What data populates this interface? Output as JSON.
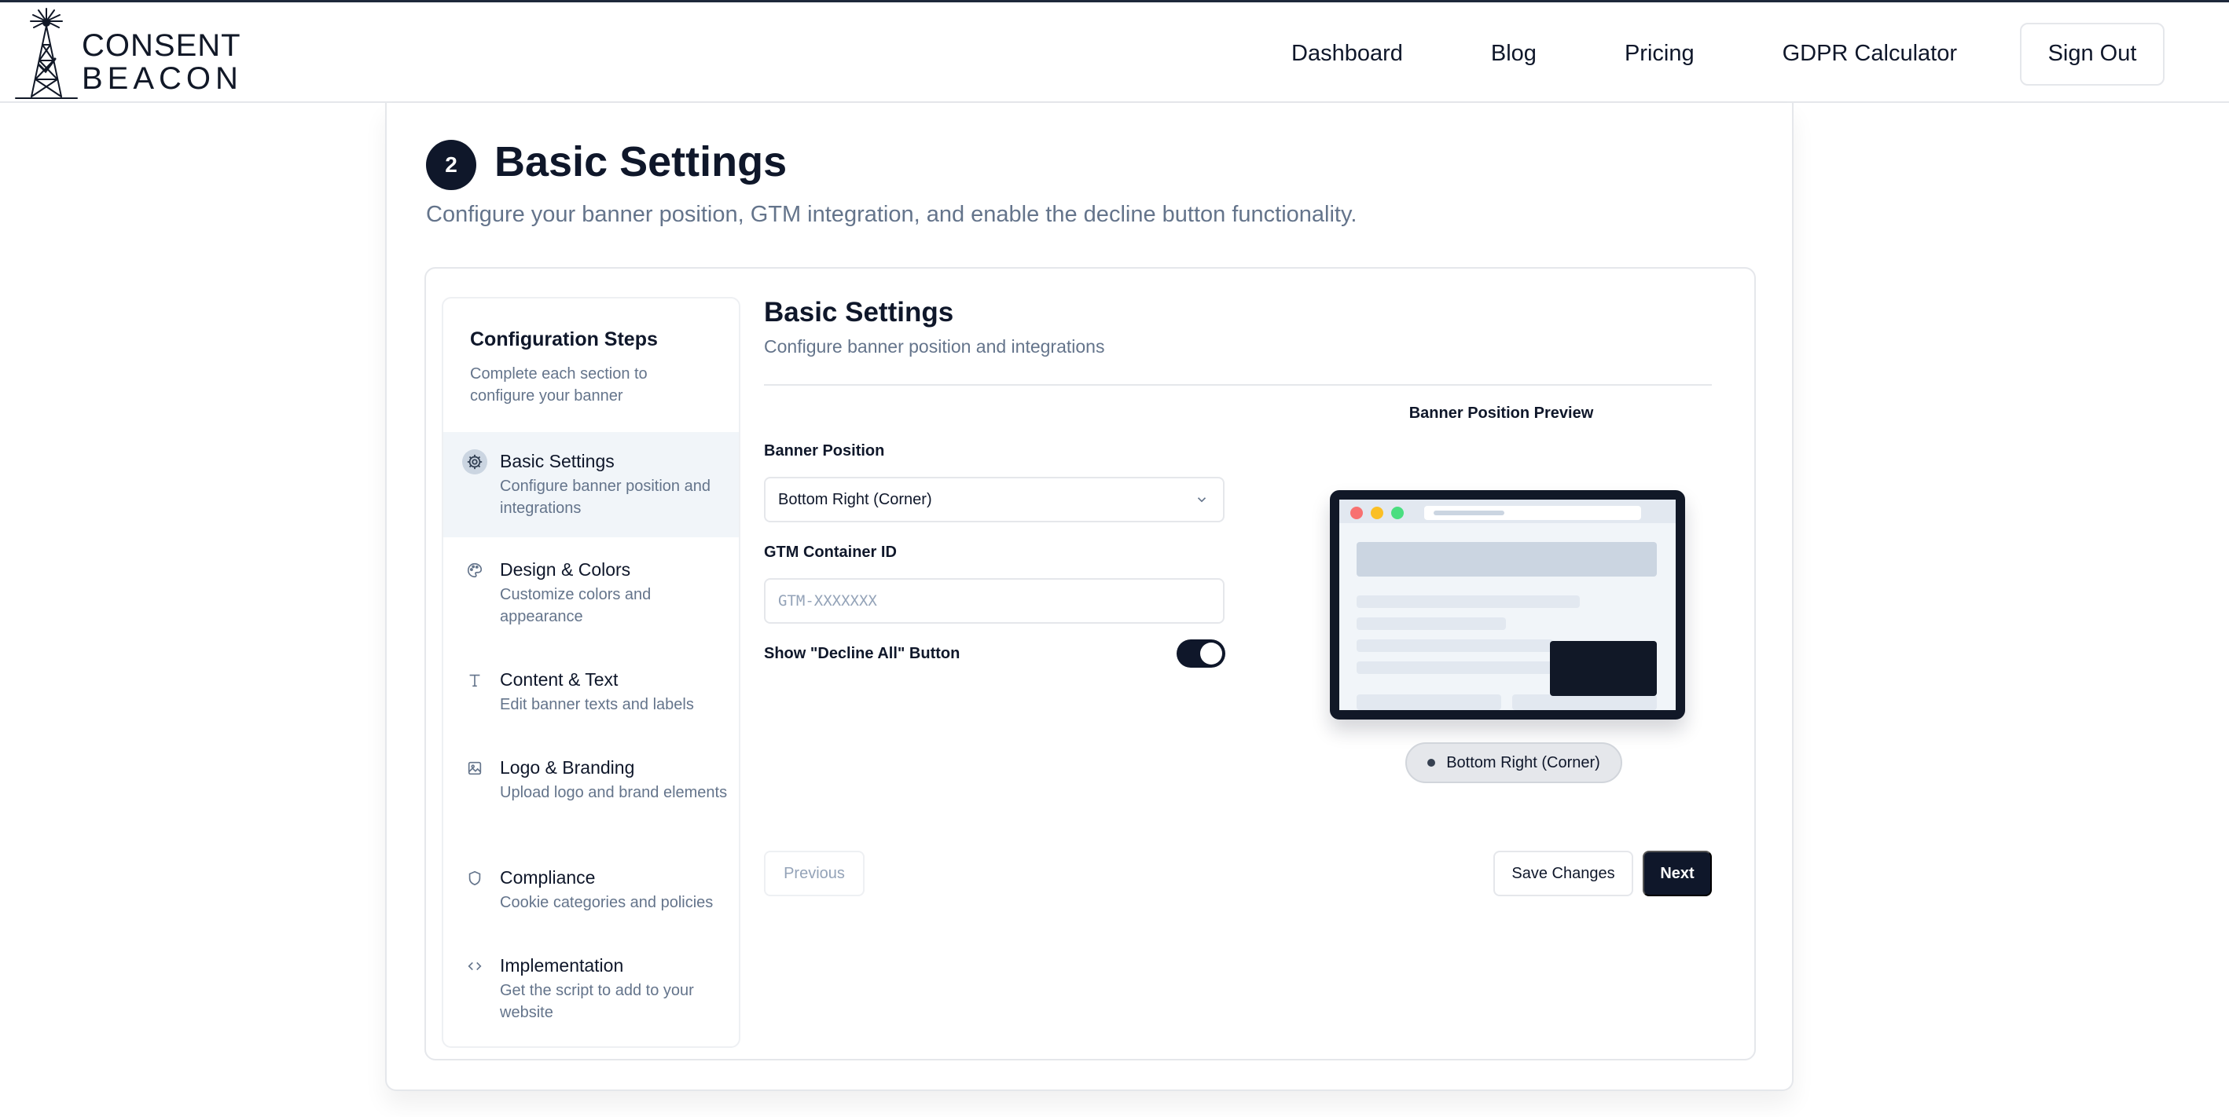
{
  "brand": {
    "line1": "CONSENT",
    "line2": "BEACON"
  },
  "nav": {
    "links": [
      "Dashboard",
      "Blog",
      "Pricing",
      "GDPR Calculator"
    ],
    "sign_out": "Sign Out"
  },
  "step": {
    "number": "2",
    "title": "Basic Settings",
    "description": "Configure your banner position, GTM integration, and enable the decline button functionality."
  },
  "sidebar": {
    "title": "Configuration Steps",
    "description": "Complete each section to configure your banner",
    "items": [
      {
        "label": "Basic Settings",
        "sub": "Configure banner position and integrations",
        "icon": "gear-icon",
        "active": true
      },
      {
        "label": "Design & Colors",
        "sub": "Customize colors and appearance",
        "icon": "palette-icon",
        "active": false
      },
      {
        "label": "Content & Text",
        "sub": "Edit banner texts and labels",
        "icon": "text-icon",
        "active": false
      },
      {
        "label": "Logo & Branding",
        "sub": "Upload logo and brand elements",
        "icon": "image-icon",
        "active": false
      },
      {
        "label": "Compliance",
        "sub": "Cookie categories and policies",
        "icon": "shield-icon",
        "active": false
      },
      {
        "label": "Implementation",
        "sub": "Get the script to add to your website",
        "icon": "code-icon",
        "active": false
      }
    ]
  },
  "content": {
    "title": "Basic Settings",
    "description": "Configure banner position and integrations",
    "banner_position_label": "Banner Position",
    "banner_position_value": "Bottom Right (Corner)",
    "gtm_label": "GTM Container ID",
    "gtm_value": "",
    "gtm_placeholder": "GTM-XXXXXXX",
    "decline_label": "Show \"Decline All\" Button",
    "decline_enabled": true
  },
  "preview": {
    "title": "Banner Position Preview",
    "position_label": "Bottom Right (Corner)"
  },
  "actions": {
    "previous": "Previous",
    "save": "Save Changes",
    "next": "Next"
  },
  "colors": {
    "primary": "#0f172a",
    "muted_text": "#64748b",
    "border": "#e5e7eb",
    "dot_red": "#f87171",
    "dot_yellow": "#fbbf24",
    "dot_green": "#4ade80"
  }
}
